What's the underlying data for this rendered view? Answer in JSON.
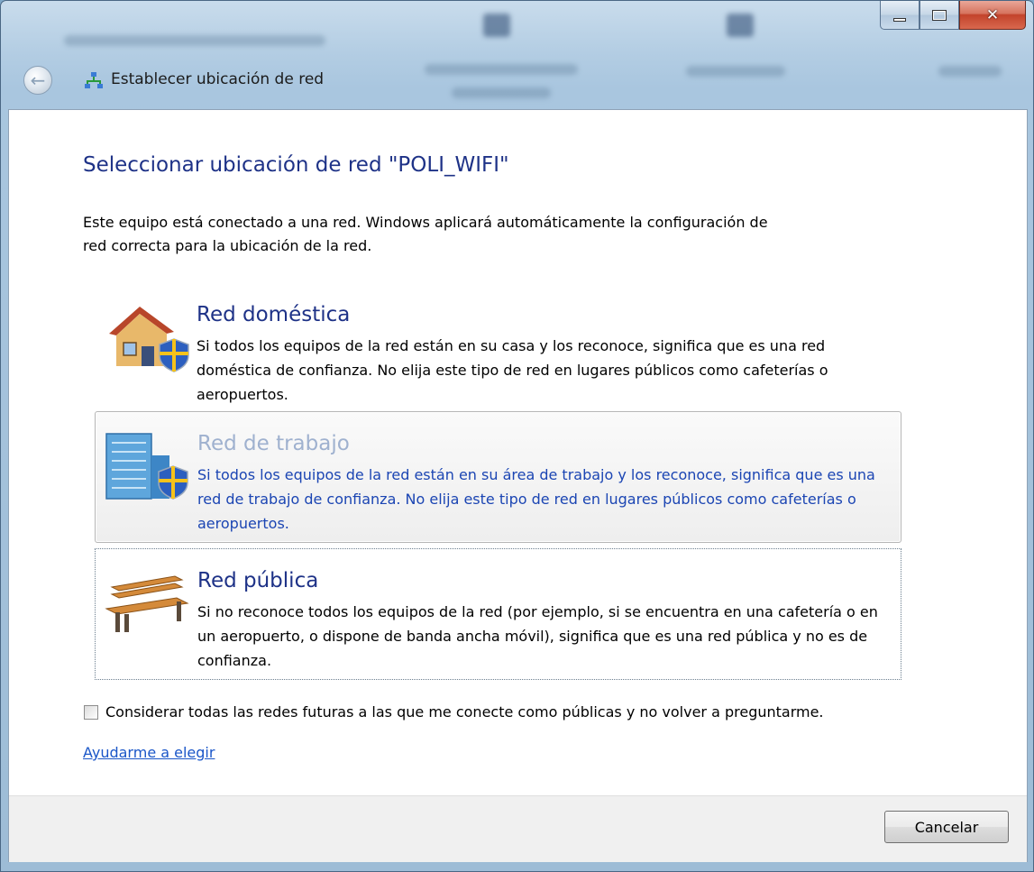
{
  "window": {
    "title": "Establecer ubicación de red",
    "controls": {
      "minimize_icon": "minimize-icon",
      "maximize_icon": "maximize-icon",
      "close_icon": "close-icon"
    }
  },
  "main": {
    "heading": "Seleccionar ubicación de red \"POLI_WIFI\"",
    "intro": "Este equipo está conectado a una red. Windows aplicará automáticamente la configuración de red correcta para la ubicación de la red."
  },
  "options": [
    {
      "title": "Red doméstica",
      "description": "Si todos los equipos de la red están en su casa y los reconoce, significa que es una red doméstica de confianza. No elija este tipo de red en lugares públicos como cafeterías o aeropuertos.",
      "icon": "house-shield-icon"
    },
    {
      "title": "Red de trabajo",
      "description": "Si todos los equipos de la red están en su área de trabajo y los reconoce, significa que es una red de trabajo de confianza. No elija este tipo de red en lugares públicos como cafeterías o aeropuertos.",
      "icon": "office-building-shield-icon"
    },
    {
      "title": "Red pública",
      "description": "Si no reconoce todos los equipos de la red (por ejemplo, si se encuentra en una cafetería o en un aeropuerto, o dispone de banda ancha móvil), significa que es una red pública y no es de confianza.",
      "icon": "park-bench-icon"
    }
  ],
  "checkbox": {
    "label": "Considerar todas las redes futuras a las que me conecte como públicas y no volver a preguntarme.",
    "checked": false
  },
  "help_link": "Ayudarme a elegir",
  "footer": {
    "cancel_label": "Cancelar"
  }
}
